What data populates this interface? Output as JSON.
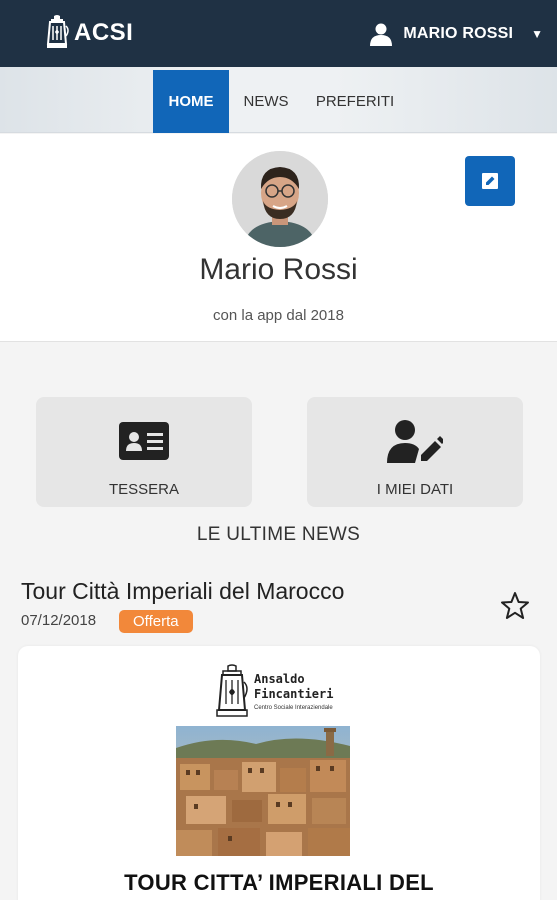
{
  "header": {
    "app_name": "ACSI",
    "user_name": "MARIO ROSSI",
    "dropdown_caret": "▼"
  },
  "nav": {
    "tabs": [
      {
        "label": "HOME",
        "active": true
      },
      {
        "label": "NEWS",
        "active": false
      },
      {
        "label": "PREFERITI",
        "active": false
      }
    ]
  },
  "profile": {
    "name": "Mario Rossi",
    "since": "con la app dal 2018"
  },
  "actions": [
    {
      "label": "TESSERA",
      "icon": "id-card-icon"
    },
    {
      "label": "I MIEI DATI",
      "icon": "user-edit-icon"
    }
  ],
  "news_section": {
    "title": "LE ULTIME NEWS"
  },
  "news": [
    {
      "title": "Tour Città Imperiali del Marocco",
      "date": "07/12/2018",
      "badge": "Offerta",
      "card": {
        "brand_name": "Ansaldo\nFincantieri",
        "brand_subtitle": "Centro Sociale Interaziendale",
        "headline": "TOUR CITTA’ IMPERIALI DEL"
      }
    }
  ],
  "colors": {
    "header_bg": "#1f3144",
    "accent": "#1166b8",
    "badge": "#f2883a",
    "tile_bg": "#e6e6e6"
  }
}
